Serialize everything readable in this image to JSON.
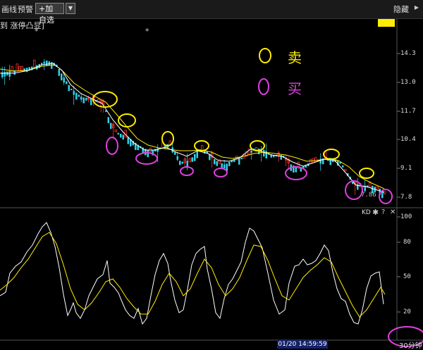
{
  "toolbar": {
    "left_fragment": "画线",
    "alert_label": "预警",
    "add_watch_label": "+加自选",
    "hide_label": "隐藏"
  },
  "indicator": {
    "name": "到 涨停凸显]"
  },
  "legend": {
    "sell_label": "卖",
    "buy_label": "买",
    "sell_color": "#ffee00",
    "buy_color": "#e040e0"
  },
  "price_axis": {
    "labels": [
      "14.3",
      "13.0",
      "11.7",
      "10.4",
      "9.1",
      "7.8"
    ]
  },
  "low_price_label": "7.86",
  "kd_panel": {
    "label": "KD",
    "axis_labels": [
      "100",
      "80",
      "50",
      "20"
    ]
  },
  "footer": {
    "time": "01/20 14:59:59",
    "period": "30分钟"
  },
  "colors": {
    "up": "#ff3030",
    "down": "#30d0e8",
    "ma_fast": "#ffffff",
    "ma_slow": "#ffee00"
  }
}
